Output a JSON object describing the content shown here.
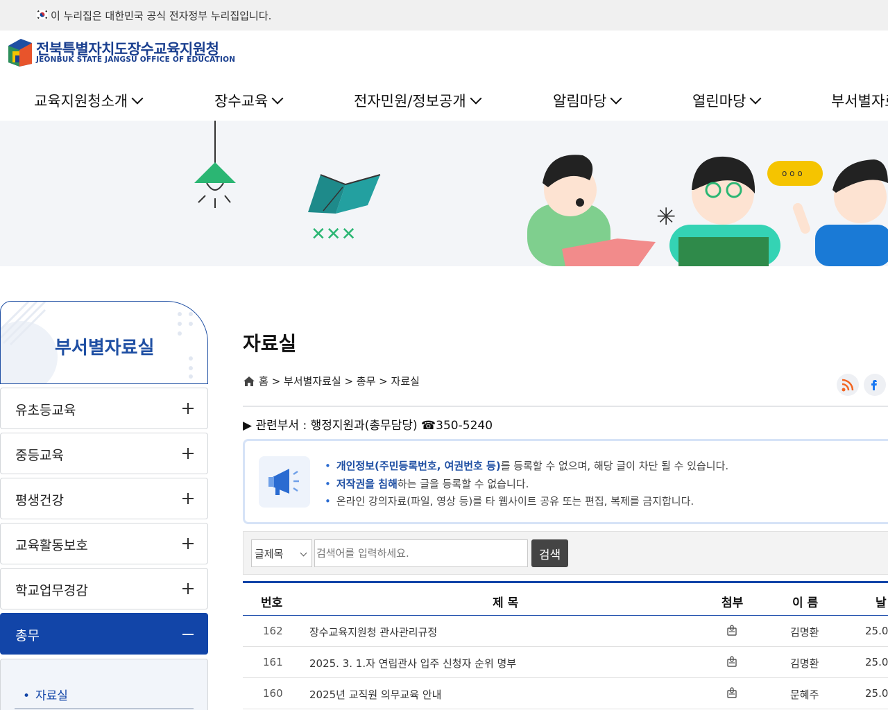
{
  "gov_banner": {
    "text": "이 누리집은 대한민국 공식 전자정부 누리집입니다."
  },
  "header": {
    "org_name": "전북특별자치도장수교육지원청",
    "org_name_en": "JEONBUK STATE JANGSU OFFICE OF EDUCATION"
  },
  "gnb": [
    {
      "label": "교육지원청소개"
    },
    {
      "label": "장수교육"
    },
    {
      "label": "전자민원/정보공개"
    },
    {
      "label": "알림마당"
    },
    {
      "label": "열린마당"
    },
    {
      "label": "부서별자료실"
    }
  ],
  "sidebar": {
    "title": "부서별자료실",
    "items": [
      {
        "label": "유초등교육"
      },
      {
        "label": "중등교육"
      },
      {
        "label": "평생건강"
      },
      {
        "label": "교육활동보호"
      },
      {
        "label": "학교업무경감"
      },
      {
        "label": "총무"
      }
    ],
    "sub_items": [
      {
        "label": "자료실"
      }
    ]
  },
  "content": {
    "title": "자료실",
    "breadcrumb": "홈 > 부서별자료실 > 총무 > 자료실",
    "dept": "▶ 관련부서 : 행정지원과(총무담당) ☎350-5240",
    "notice": {
      "line1_bold": "개인정보(주민등록번호, 여권번호 등)",
      "line1_rest": "를 등록할 수 없으며, 해당 글이 차단 될 수 있습니다.",
      "line2_bold": "저작권을 침해",
      "line2_rest": "하는 글을 등록할 수 없습니다.",
      "line3": "온라인 강의자료(파일, 영상 등)를 타 웹사이트 공유 또는 편집, 복제를 금지합니다."
    },
    "search": {
      "select_value": "글제목",
      "placeholder": "검색어를 입력하세요.",
      "button": "검색"
    },
    "table": {
      "headers": {
        "num": "번호",
        "title": "제 목",
        "attach": "첨부",
        "name": "이 름",
        "date": "날"
      },
      "rows": [
        {
          "num": "162",
          "title": "장수교육지원청 관사관리규정",
          "name": "김명환",
          "date": "25.0"
        },
        {
          "num": "161",
          "title": "2025. 3. 1.자 연립관사 입주 신청자 순위 명부",
          "name": "김명환",
          "date": "25.0"
        },
        {
          "num": "160",
          "title": "2025년 교직원 의무교육 안내",
          "name": "문혜주",
          "date": "25.0"
        }
      ]
    }
  },
  "colors": {
    "brand_blue": "#1245a8",
    "active_menu": "#1245a8",
    "hero_bg": "#f3f5f8"
  }
}
